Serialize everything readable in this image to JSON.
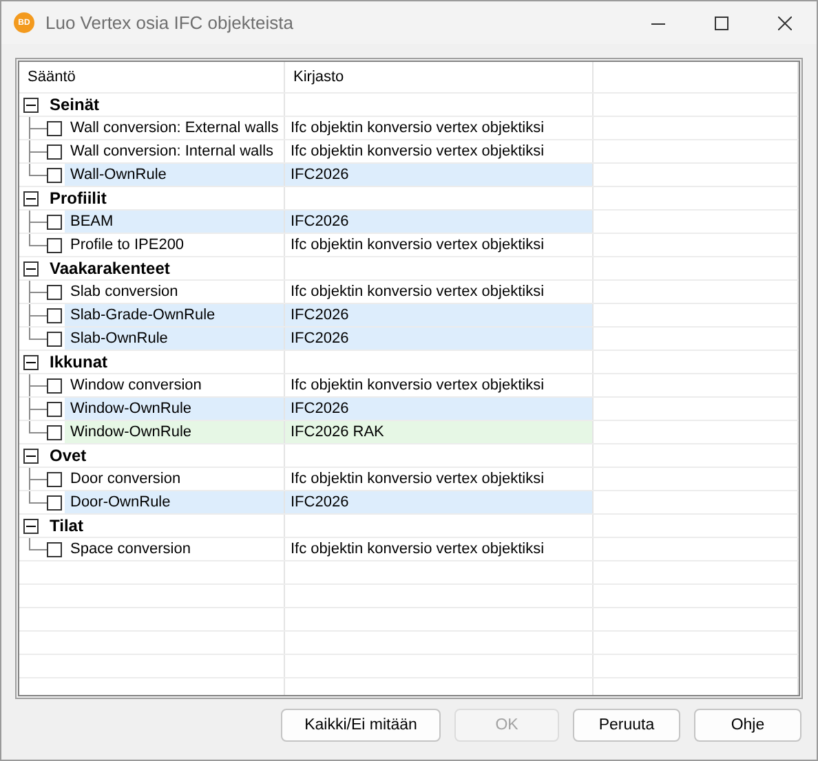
{
  "window": {
    "title": "Luo Vertex osia IFC objekteista",
    "logo_text": "BD"
  },
  "table": {
    "columns": [
      "Sääntö",
      "Kirjasto"
    ],
    "groups": [
      {
        "label": "Seinät",
        "expanded": true,
        "children": [
          {
            "name": "Wall conversion: External walls",
            "library": "Ifc objektin konversio vertex objektiksi",
            "checked": false
          },
          {
            "name": "Wall conversion: Internal walls",
            "library": "Ifc objektin konversio vertex objektiksi",
            "checked": false
          },
          {
            "name": "Wall-OwnRule",
            "library": "IFC2026",
            "checked": false,
            "color": "#ddedfc"
          }
        ]
      },
      {
        "label": "Profiilit",
        "expanded": true,
        "children": [
          {
            "name": "BEAM",
            "library": "IFC2026",
            "checked": false,
            "color": "#ddedfc"
          },
          {
            "name": "Profile to IPE200",
            "library": "Ifc objektin konversio vertex objektiksi",
            "checked": false
          }
        ]
      },
      {
        "label": "Vaakarakenteet",
        "expanded": true,
        "children": [
          {
            "name": "Slab conversion",
            "library": "Ifc objektin konversio vertex objektiksi",
            "checked": false
          },
          {
            "name": "Slab-Grade-OwnRule",
            "library": "IFC2026",
            "checked": false,
            "color": "#ddedfc"
          },
          {
            "name": "Slab-OwnRule",
            "library": "IFC2026",
            "checked": false,
            "color": "#ddedfc"
          }
        ]
      },
      {
        "label": "Ikkunat",
        "expanded": true,
        "children": [
          {
            "name": "Window conversion",
            "library": "Ifc objektin konversio vertex objektiksi",
            "checked": false
          },
          {
            "name": "Window-OwnRule",
            "library": "IFC2026",
            "checked": false,
            "color": "#ddedfc"
          },
          {
            "name": "Window-OwnRule",
            "library": "IFC2026 RAK",
            "checked": false,
            "color": "#e6f7e5"
          }
        ]
      },
      {
        "label": "Ovet",
        "expanded": true,
        "children": [
          {
            "name": "Door conversion",
            "library": "Ifc objektin konversio vertex objektiksi",
            "checked": false
          },
          {
            "name": "Door-OwnRule",
            "library": "IFC2026",
            "checked": false,
            "color": "#ddedfc"
          }
        ]
      },
      {
        "label": "Tilat",
        "expanded": true,
        "children": [
          {
            "name": "Space conversion",
            "library": "Ifc objektin konversio vertex objektiksi",
            "checked": false
          }
        ]
      }
    ]
  },
  "buttons": [
    {
      "label": "Kaikki/Ei mitään",
      "disabled": false
    },
    {
      "label": "OK",
      "disabled": true
    },
    {
      "label": "Peruuta",
      "disabled": false
    },
    {
      "label": "Ohje",
      "disabled": false
    }
  ]
}
